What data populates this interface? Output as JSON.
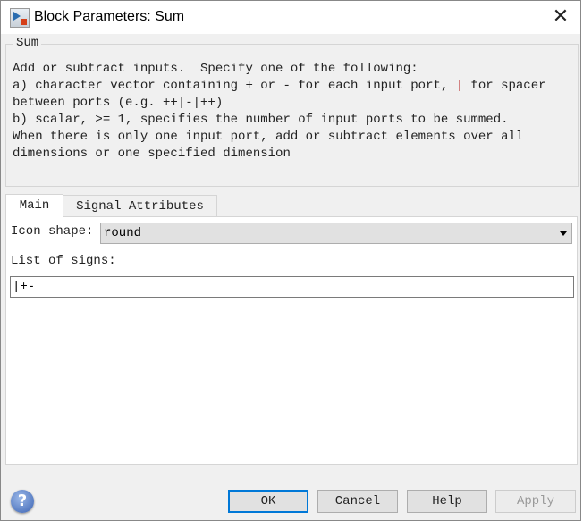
{
  "window": {
    "title": "Block Parameters: Sum",
    "close": "✕"
  },
  "group": {
    "label": "Sum",
    "lines": [
      "Add or subtract inputs.  Specify one of the following:",
      "a) character vector containing + or - for each input port, ",
      "|",
      " for spacer",
      "between ports (e.g. ++|-|++)",
      "b) scalar, >= 1, specifies the number of input ports to be summed.",
      "When there is only one input port, add or subtract elements over all",
      "dimensions or one specified dimension"
    ]
  },
  "tabs": [
    {
      "label": "Main",
      "active": true
    },
    {
      "label": "Signal Attributes",
      "active": false
    }
  ],
  "main": {
    "icon_shape_label": "Icon shape:",
    "icon_shape_value": "round",
    "signs_label": "List of signs:",
    "signs_value": "|+-"
  },
  "buttons": {
    "ok": "OK",
    "cancel": "Cancel",
    "help": "Help",
    "apply": "Apply",
    "help_icon": "?"
  },
  "colors": {
    "accent": "#0078d7"
  }
}
